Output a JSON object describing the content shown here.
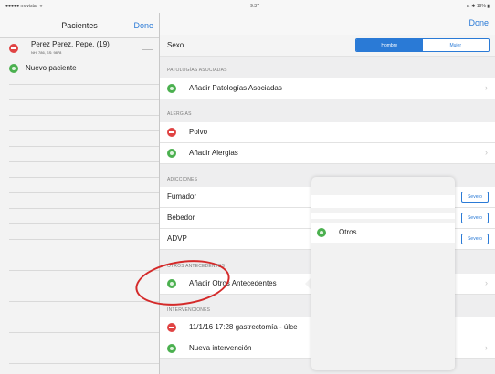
{
  "status_bar": {
    "carrier": "●●●●● movistar ᯤ",
    "time": "9:37",
    "battery": "⊾ ✱ 19% ▮"
  },
  "left": {
    "title": "Pacientes",
    "done": "Done",
    "patient": {
      "name": "Perez Perez, Pepe. (19)",
      "sub": "NH: 786, SS: 9878"
    },
    "new_patient": "Nuevo paciente"
  },
  "right": {
    "done": "Done",
    "sexo": {
      "label": "Sexo",
      "options": [
        "Hombre",
        "Mujer"
      ],
      "selected": "Hombre"
    },
    "sections": {
      "patologias": "PATOLOGÍAS ASOCIADAS",
      "alergias": "ALERGIAS",
      "adicciones": "ADICCIONES",
      "otros": "OTROS ANTECEDENTES",
      "intervenciones": "INTERVENCIONES"
    },
    "add_patologias": "Añadir Patologías Asociadas",
    "alergia_polvo": "Polvo",
    "add_alergias": "Añadir Alergias",
    "adicciones": [
      {
        "label": "Fumador",
        "severity": "Severo"
      },
      {
        "label": "Bebedor",
        "severity": "Severo"
      },
      {
        "label": "ADVP",
        "severity": "Severo"
      }
    ],
    "add_otros": "Añadir Otros Antecedentes",
    "intervencion": "11/1/16 17:28 gastrectomía - úlce",
    "new_intervencion": "Nueva intervención"
  },
  "popover": {
    "option": "Otros"
  },
  "colors": {
    "accent": "#2a7ad6",
    "delete": "#e04343",
    "add": "#4bb04f",
    "annotation": "#d42a2a"
  }
}
